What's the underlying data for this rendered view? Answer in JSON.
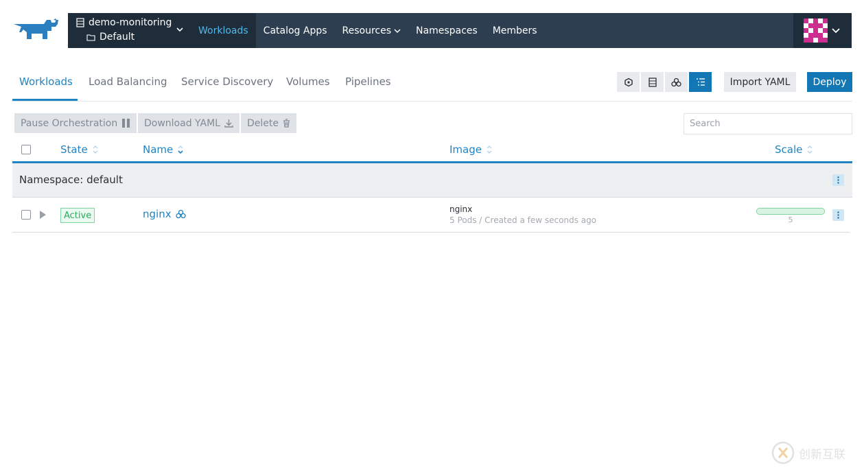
{
  "header": {
    "cluster": {
      "name": "demo-monitoring",
      "project": "Default"
    },
    "nav": [
      {
        "label": "Workloads",
        "active": true
      },
      {
        "label": "Catalog Apps"
      },
      {
        "label": "Resources",
        "has_caret": true
      },
      {
        "label": "Namespaces"
      },
      {
        "label": "Members"
      }
    ]
  },
  "subtabs": [
    "Workloads",
    "Load Balancing",
    "Service Discovery",
    "Volumes",
    "Pipelines"
  ],
  "view_buttons": [
    "node-view-icon",
    "node-list-icon",
    "workload-group-icon",
    "flat-list-icon"
  ],
  "actions": {
    "import_yaml": "Import YAML",
    "deploy": "Deploy"
  },
  "bulk": {
    "pause": "Pause Orchestration",
    "download": "Download YAML",
    "delete": "Delete"
  },
  "search": {
    "placeholder": "Search"
  },
  "table": {
    "columns": {
      "state": "State",
      "name": "Name",
      "image": "Image",
      "scale": "Scale"
    },
    "group": {
      "label": "Namespace: default"
    },
    "rows": [
      {
        "state": "Active",
        "name": "nginx",
        "image": "nginx",
        "meta": "5 Pods / Created a few seconds ago",
        "scale": "5",
        "scale_fraction": 1.0
      }
    ]
  },
  "watermark": "创新互联",
  "colors": {
    "primary": "#1477b5",
    "link": "#2183c2",
    "header": "#2d3e50",
    "header_dark": "#1f2d3b",
    "active_green": "#2eaa5e"
  }
}
